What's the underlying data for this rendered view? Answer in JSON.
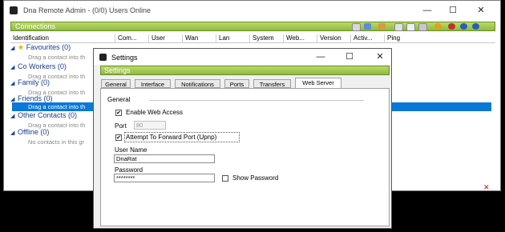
{
  "main": {
    "title": "Dna Remote Admin - (0/0) Users Online",
    "minimize": "—",
    "maximize": "☐",
    "close": "✕",
    "connections_label": "Connections",
    "columns": [
      "Identification",
      "Com...",
      "User",
      "Wan",
      "Lan",
      "System",
      "Web...",
      "Version",
      "Activ...",
      "Ping"
    ],
    "groups": [
      {
        "label": "Favourites (0)",
        "hint": "Drag a contact into th"
      },
      {
        "label": "Co Workers (0)",
        "hint": "Drag a contact into th"
      },
      {
        "label": "Family (0)",
        "hint": "Drag a contact into th"
      },
      {
        "label": "Friends (0)",
        "hint": "Drag a contact into th"
      },
      {
        "label": "Other Contacts (0)",
        "hint": "Drag a contact into th"
      },
      {
        "label": "Offline (0)",
        "hint": "No contacts in this gr"
      }
    ],
    "status_icon": "✕"
  },
  "settings": {
    "title": "Settings",
    "minimize": "—",
    "maximize": "☐",
    "close": "✕",
    "bar_label": "Settings",
    "tabs": [
      "General",
      "Interface",
      "Notifications",
      "Ports",
      "Transfers",
      "Web Server"
    ],
    "active_tab": "Web Server",
    "general_group": "General",
    "enable_web_access": "Enable Web Access",
    "port_label": "Port",
    "port_value": "80",
    "forward_port": "Attempt To Forward Port (Upnp)",
    "username_label": "User Name",
    "username_value": "DnaRat",
    "password_label": "Password",
    "password_value": "********",
    "show_password": "Show Password"
  }
}
